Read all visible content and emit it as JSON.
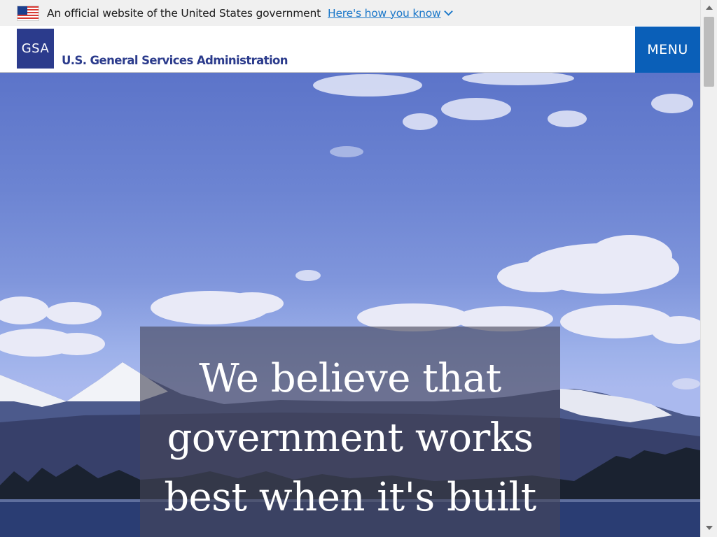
{
  "gov_banner": {
    "text": "An official website of the United States government",
    "link": "Here's how you know"
  },
  "header": {
    "logo_text": "GSA",
    "agency_name": "U.S. General Services Administration",
    "menu_label": "MENU"
  },
  "hero": {
    "line1": "We believe that",
    "line2": "government works",
    "line3": "best when it's built"
  },
  "colors": {
    "brand_navy": "#2b3b8c",
    "menu_blue": "#0a5fb8",
    "link_blue": "#1a77c9",
    "banner_bg": "#f0f0f0"
  },
  "icons": {
    "flag": "us-flag-icon",
    "chevron": "chevron-down-icon"
  }
}
